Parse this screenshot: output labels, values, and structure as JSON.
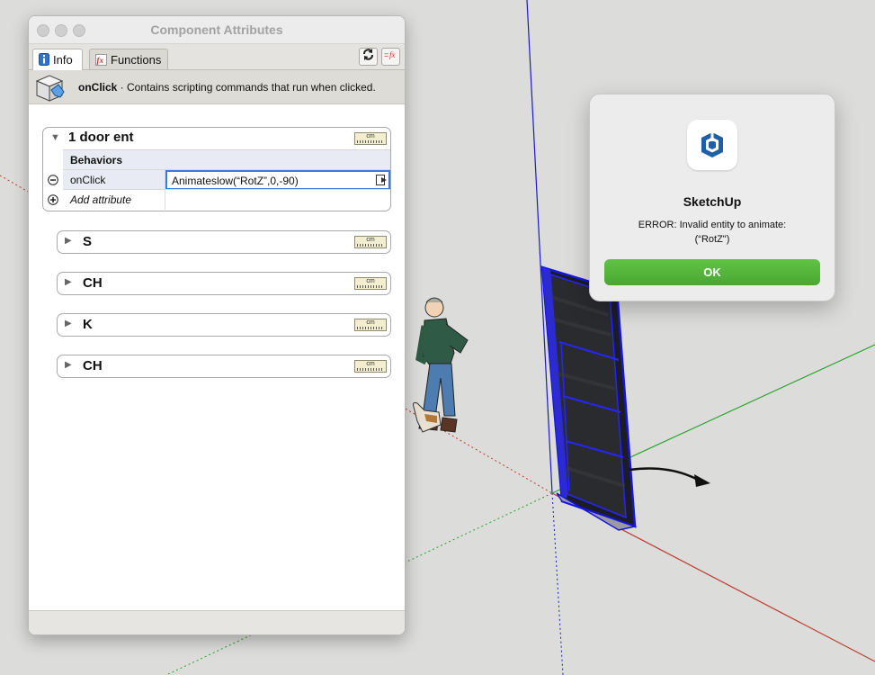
{
  "panel": {
    "title": "Component Attributes",
    "tabs": [
      {
        "label": "Info",
        "active": true
      },
      {
        "label": "Functions",
        "active": false
      }
    ],
    "info": {
      "attribute": "onClick",
      "description": " · Contains scripting commands that run when clicked."
    },
    "component": {
      "name": "1 door ent",
      "unit": "cm",
      "section_header": "Behaviors",
      "attribute_name": "onClick",
      "attribute_value": "Animateslow(“RotZ”,0,-90)",
      "add_attribute_label": "Add attribute"
    },
    "subcomponents": [
      {
        "name": "S",
        "unit": "cm"
      },
      {
        "name": "CH",
        "unit": "cm"
      },
      {
        "name": "K",
        "unit": "cm"
      },
      {
        "name": "CH",
        "unit": "cm"
      }
    ]
  },
  "alert": {
    "app_name": "SketchUp",
    "message_line1": "ERROR: Invalid entity to animate:",
    "message_line2": "(“RotZ\")",
    "ok_label": "OK",
    "accent_color": "#55b53b"
  },
  "colors": {
    "background": "#dcdcda",
    "axis_red": "#c0392b",
    "axis_green": "#27a327",
    "axis_blue": "#1a1acc",
    "selection_blue": "#1515e0"
  }
}
